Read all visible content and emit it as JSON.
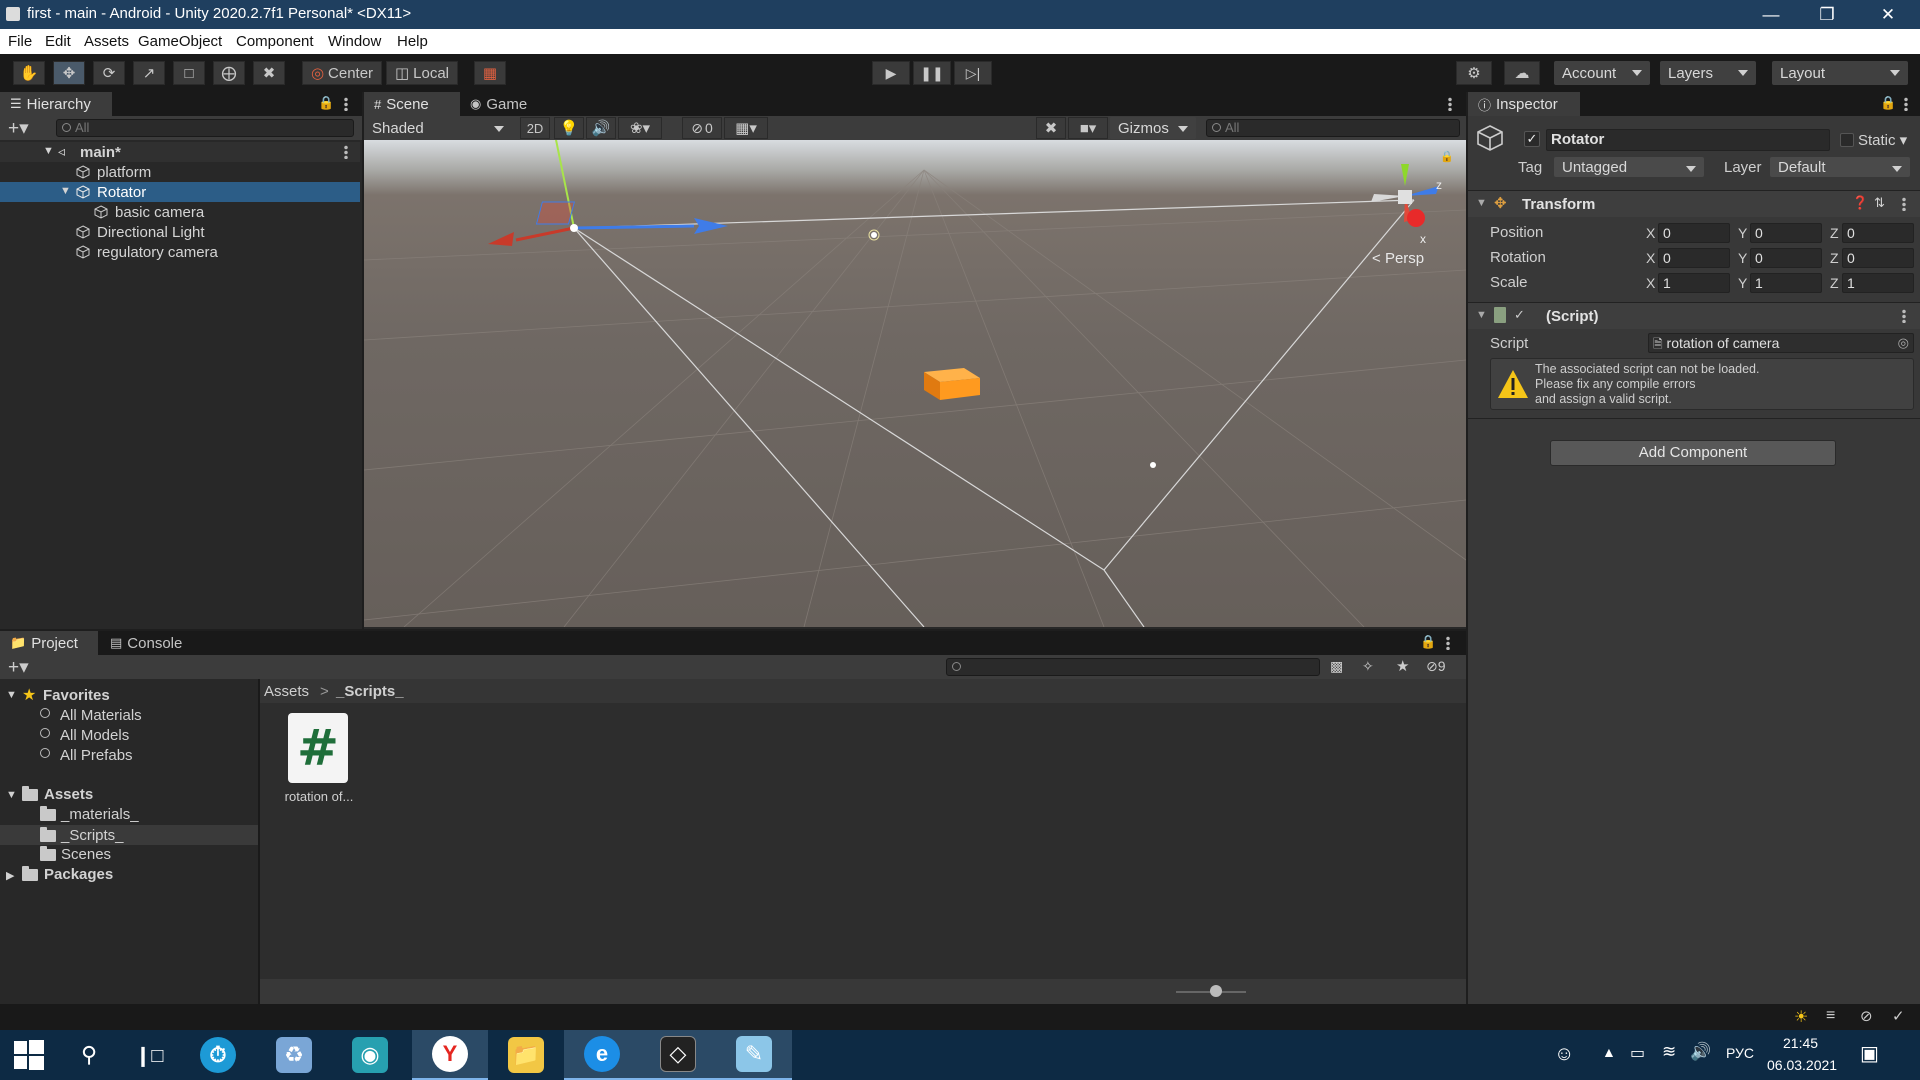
{
  "window": {
    "title": "first - main - Android - Unity 2020.2.7f1 Personal* <DX11>"
  },
  "menu": [
    "File",
    "Edit",
    "Assets",
    "GameObject",
    "Component",
    "Window",
    "Help"
  ],
  "toolbar": {
    "center_label": "Center",
    "local_label": "Local",
    "account_label": "Account",
    "layers_label": "Layers",
    "layout_label": "Layout"
  },
  "hierarchy": {
    "tab": "Hierarchy",
    "search_placeholder": "All",
    "scene": "main*",
    "items": [
      "platform",
      "Rotator",
      "basic camera",
      "Directional Light",
      "regulatory camera"
    ]
  },
  "scene": {
    "tab_scene": "Scene",
    "tab_game": "Game",
    "shading": "Shaded",
    "mode_2d": "2D",
    "hidden_count": "0",
    "gizmos": "Gizmos",
    "search_placeholder": "All",
    "persp": "Persp",
    "axis_z": "z",
    "axis_x": "x"
  },
  "inspector": {
    "tab": "Inspector",
    "object_name": "Rotator",
    "static_label": "Static",
    "tag_label": "Tag",
    "tag_value": "Untagged",
    "layer_label": "Layer",
    "layer_value": "Default",
    "transform": {
      "title": "Transform",
      "position_label": "Position",
      "rotation_label": "Rotation",
      "scale_label": "Scale",
      "position": {
        "x": "0",
        "y": "0",
        "z": "0"
      },
      "rotation": {
        "x": "0",
        "y": "0",
        "z": "0"
      },
      "scale": {
        "x": "1",
        "y": "1",
        "z": "1"
      },
      "axis_x": "X",
      "axis_y": "Y",
      "axis_z": "Z"
    },
    "script_component": {
      "title": "(Script)",
      "script_label": "Script",
      "script_value": "rotation of camera",
      "warning_1": "The associated script can not be loaded.",
      "warning_2": "Please fix any compile errors",
      "warning_3": "and assign a valid script."
    },
    "add_component": "Add Component"
  },
  "project": {
    "tab_project": "Project",
    "tab_console": "Console",
    "hidden_count": "9",
    "favorites": "Favorites",
    "fav_items": [
      "All Materials",
      "All Models",
      "All Prefabs"
    ],
    "assets": "Assets",
    "asset_folders": [
      "_materials_",
      "_Scripts_",
      "Scenes"
    ],
    "packages": "Packages",
    "breadcrumb_root": "Assets",
    "breadcrumb_sep": ">",
    "breadcrumb_current": "_Scripts_",
    "file_name": "rotation of...",
    "file_glyph": "#"
  },
  "taskbar": {
    "lang": "РУС",
    "time": "21:45",
    "date": "06.03.2021"
  },
  "colors": {
    "titlebar": "#1f3f5f",
    "selection": "#2c5d87",
    "panel": "#282828",
    "taskbar": "#0d2a44",
    "cube": "#ff9a1f"
  }
}
